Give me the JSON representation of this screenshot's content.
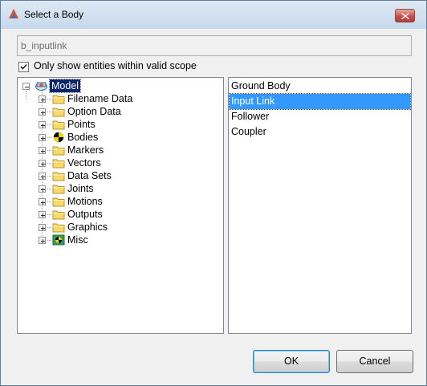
{
  "window": {
    "title": "Select a Body",
    "icon": "altair-logo-icon",
    "close_icon": "close-icon"
  },
  "name_field": {
    "value": "b_inputlink"
  },
  "scope_checkbox": {
    "label": "Only show entities within valid scope",
    "checked": true
  },
  "tree": {
    "root": {
      "label": "Model",
      "icon": "model-icon",
      "expanded": true,
      "selected": true
    },
    "items": [
      {
        "label": "Filename Data",
        "icon": "folder-icon"
      },
      {
        "label": "Option Data",
        "icon": "folder-icon"
      },
      {
        "label": "Points",
        "icon": "folder-icon"
      },
      {
        "label": "Bodies",
        "icon": "body-icon"
      },
      {
        "label": "Markers",
        "icon": "folder-icon"
      },
      {
        "label": "Vectors",
        "icon": "folder-icon"
      },
      {
        "label": "Data Sets",
        "icon": "folder-icon"
      },
      {
        "label": "Joints",
        "icon": "folder-icon"
      },
      {
        "label": "Motions",
        "icon": "folder-icon"
      },
      {
        "label": "Outputs",
        "icon": "folder-icon"
      },
      {
        "label": "Graphics",
        "icon": "folder-icon"
      },
      {
        "label": "Misc",
        "icon": "misc-icon"
      }
    ]
  },
  "list": {
    "items": [
      "Ground Body",
      "Input Link",
      "Follower",
      "Coupler"
    ],
    "selected_index": 1
  },
  "buttons": {
    "ok": "OK",
    "cancel": "Cancel"
  },
  "colors": {
    "selection_blue": "#3399ff",
    "tree_selection": "#0a246a",
    "folder": "#f5d96b"
  }
}
